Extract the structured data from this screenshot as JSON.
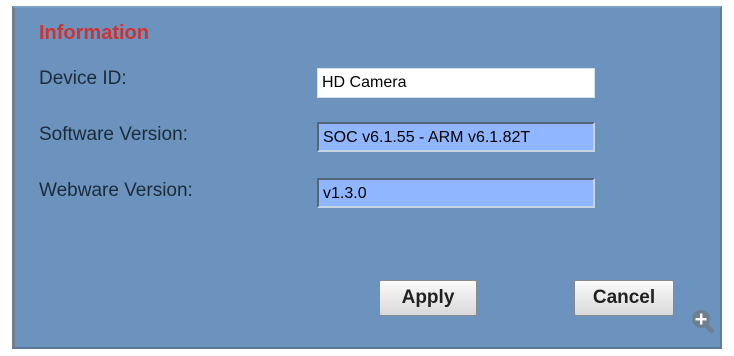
{
  "panel": {
    "title": "Information"
  },
  "fields": {
    "device_id": {
      "label": "Device ID:",
      "value": "HD Camera"
    },
    "software_version": {
      "label": "Software Version:",
      "value": "SOC v6.1.55 - ARM v6.1.82T"
    },
    "webware_version": {
      "label": "Webware Version:",
      "value": "v1.3.0"
    }
  },
  "buttons": {
    "apply_label": "Apply",
    "cancel_label": "Cancel"
  },
  "icons": {
    "zoom": "zoom-in-icon"
  },
  "colors": {
    "panel_background": "#6b93bd",
    "title": "#cc3333",
    "readonly_field": "#8fb6ff"
  }
}
